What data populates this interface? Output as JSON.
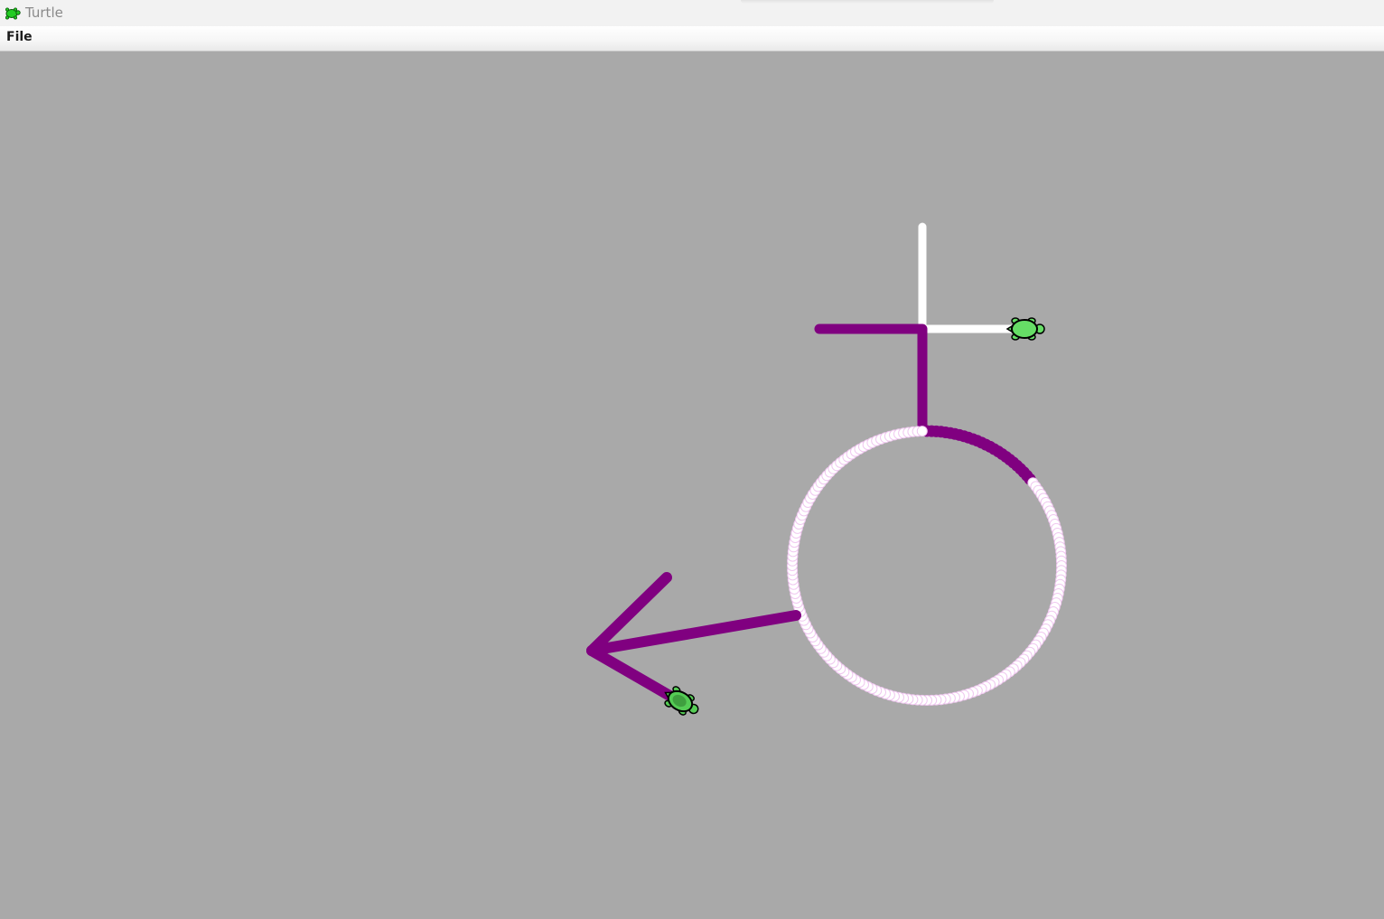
{
  "window": {
    "title": "Turtle",
    "icon": "turtle-icon"
  },
  "menu": {
    "items": [
      {
        "label": "File"
      }
    ]
  },
  "canvas": {
    "background": "#a9a9a9",
    "colors": {
      "pen_purple": "#800080",
      "pen_white": "#ffffff",
      "circle_dot_outline": "#f0c8f0",
      "turtle_body": "#66dd66",
      "turtle_shell_dark": "#3f9f3f",
      "turtle_outline": "#000000"
    },
    "turtles": [
      {
        "name": "turtle-right",
        "heading": "east"
      },
      {
        "name": "turtle-lower-left",
        "heading": "southeast"
      }
    ]
  }
}
